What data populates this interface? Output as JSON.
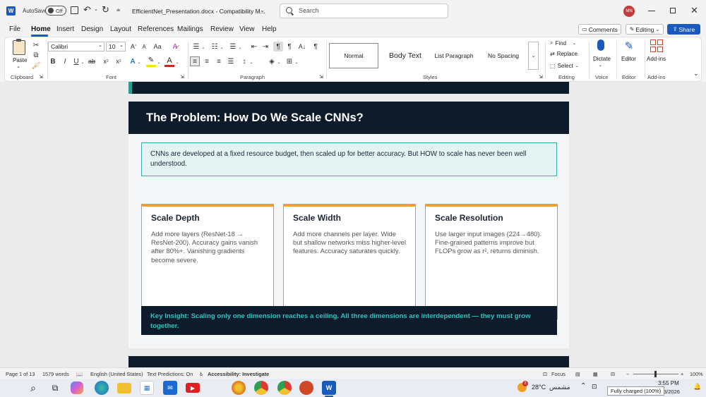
{
  "titlebar": {
    "autosave_label": "AutoSave",
    "autosave_state": "Off",
    "doc_title": "EfficientNet_Presentation.docx - Compatibility M...",
    "search_placeholder": "Search",
    "avatar_initials": "MN"
  },
  "menu": {
    "items": [
      "File",
      "Home",
      "Insert",
      "Design",
      "Layout",
      "References",
      "Mailings",
      "Review",
      "View",
      "Help"
    ],
    "active": "Home",
    "comments_label": "Comments",
    "editing_label": "Editing",
    "share_label": "Share"
  },
  "ribbon": {
    "paste_label": "Paste",
    "clipboard_label": "Clipboard",
    "font_name": "Calibri",
    "font_size": "10",
    "font_label": "Font",
    "paragraph_label": "Paragraph",
    "styles": [
      "Normal",
      "Body Text",
      "List Paragraph",
      "No Spacing"
    ],
    "styles_label": "Styles",
    "find_label": "Find",
    "replace_label": "Replace",
    "select_label": "Select",
    "editing_group_label": "Editing",
    "dictate_label": "Dictate",
    "voice_label": "Voice",
    "editor_label": "Editor",
    "editor_group_label": "Editor",
    "addins_label": "Add-ins",
    "addins_group_label": "Add-ins"
  },
  "document": {
    "heading": "The Problem: How Do We Scale CNNs?",
    "intro_text": "CNNs are developed at a fixed resource budget, then scaled up for better accuracy. But HOW to scale has never been well understood.",
    "cards": [
      {
        "title": "Scale Depth",
        "body": "Add more layers (ResNet-18 → ResNet-200). Accuracy gains vanish after 80%+. Vanishing gradients become severe."
      },
      {
        "title": "Scale Width",
        "body": "Add more channels per layer. Wide but shallow networks miss higher-level features. Accuracy saturates quickly."
      },
      {
        "title": "Scale Resolution",
        "body": "Use larger input images (224→480). Fine-grained patterns improve but FLOPs grow as r², returns diminish."
      }
    ],
    "insight_text": "Key Insight: Scaling only one dimension reaches a ceiling. All three dimensions are interdependent — they must grow together."
  },
  "statusbar": {
    "page_info": "Page 1 of 13",
    "word_count": "1579 words",
    "language": "English (United States)",
    "text_predictions": "Text Predictions: On",
    "accessibility": "Accessibility: Investigate",
    "focus_label": "Focus",
    "zoom": "100%"
  },
  "taskbar": {
    "weather_temp": "28°C",
    "weather_text": "مشمس",
    "weather_badge": "2",
    "time": "3:55 PM",
    "date_partial": "3/2026",
    "tooltip": "Fully charged (100%)"
  },
  "colors": {
    "word_blue": "#185abd",
    "navy": "#0d1b2a",
    "teal_text": "#2ec4b6",
    "orange": "#f0a030",
    "intro_bg": "#e4f4f3",
    "intro_border": "#3aaea5"
  }
}
